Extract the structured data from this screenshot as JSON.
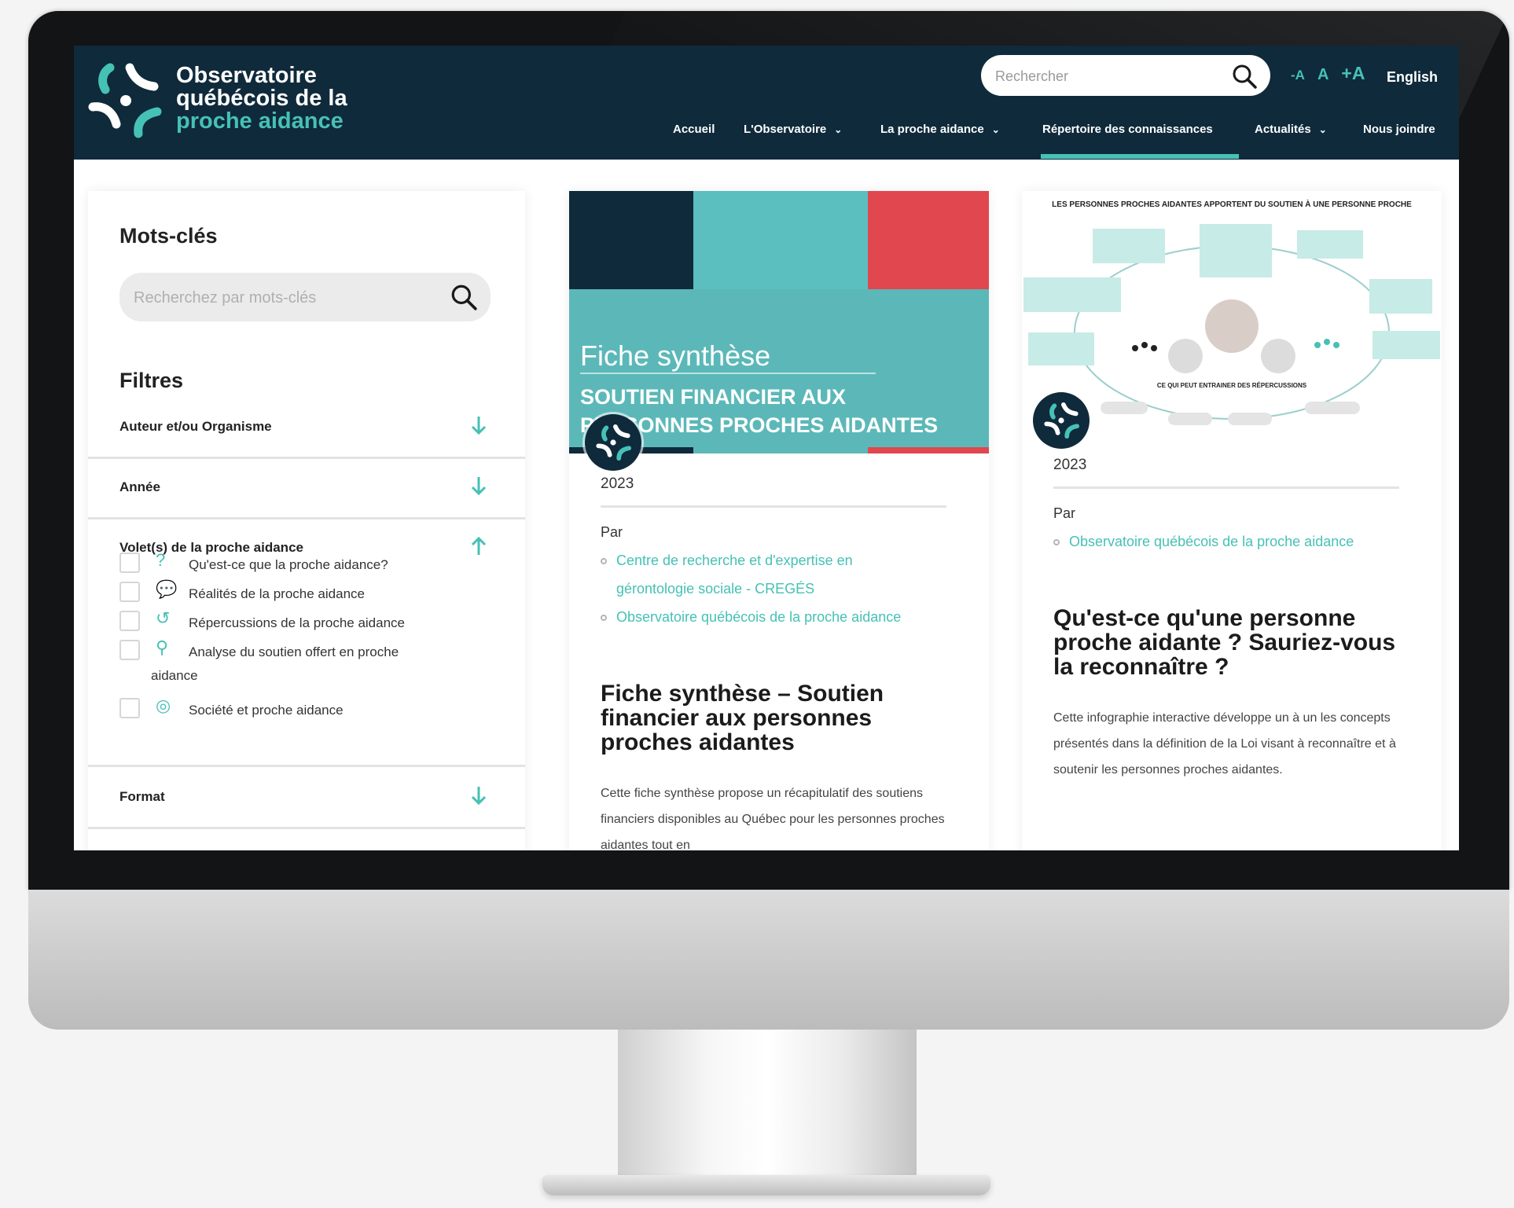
{
  "brand": {
    "line1": "Observatoire",
    "line2": "québécois de la",
    "line3": "proche aidance",
    "colors": {
      "navy": "#0f2a3b",
      "teal": "#46c1b5",
      "red": "#e0474f"
    }
  },
  "header": {
    "search_placeholder": "Rechercher",
    "font_controls": [
      "-A",
      "A",
      "+A"
    ],
    "language": "English"
  },
  "nav": {
    "items": [
      {
        "label": "Accueil",
        "has_dropdown": false
      },
      {
        "label": "L'Observatoire",
        "has_dropdown": true
      },
      {
        "label": "La proche aidance",
        "has_dropdown": true
      },
      {
        "label": "Répertoire des connaissances",
        "has_dropdown": false,
        "active": true
      },
      {
        "label": "Actualités",
        "has_dropdown": true
      },
      {
        "label": "Nous joindre",
        "has_dropdown": false
      }
    ]
  },
  "filters": {
    "keywords_heading": "Mots-clés",
    "keywords_placeholder": "Recherchez par mots-clés",
    "filters_heading": "Filtres",
    "groups": [
      {
        "label": "Auteur et/ou Organisme",
        "expanded": false
      },
      {
        "label": "Année",
        "expanded": false
      },
      {
        "label": "Volet(s) de la proche aidance",
        "expanded": true
      },
      {
        "label": "Format",
        "expanded": false
      }
    ],
    "volets": [
      {
        "label": "Qu'est-ce que la proche aidance?",
        "icon": "question-icon"
      },
      {
        "label": "Réalités de la proche aidance",
        "icon": "chat-icon"
      },
      {
        "label": "Répercussions de la proche aidance",
        "icon": "cycle-icon"
      },
      {
        "label": "Analyse du soutien offert en proche",
        "label_cont": "aidance",
        "icon": "magnifier-icon"
      },
      {
        "label": "Société et proche aidance",
        "icon": "globe-icon"
      }
    ]
  },
  "cards": [
    {
      "thumb_line1": "Fiche synthèse",
      "thumb_line2": "SOUTIEN FINANCIER AUX",
      "thumb_line3": "PERSONNES PROCHES AIDANTES",
      "year": "2023",
      "by_label": "Par",
      "authors": [
        "Centre de recherche et d'expertise en gérontologie sociale - CREGÉS",
        "Observatoire québécois de la proche aidance"
      ],
      "title": "Fiche synthèse – Soutien financier aux personnes proches aidantes",
      "description": "Cette fiche synthèse propose un récapitulatif des soutiens financiers disponibles au Québec pour les personnes proches aidantes tout en"
    },
    {
      "thumb_heading": "LES PERSONNES PROCHES AIDANTES APPORTENT DU SOUTIEN À UNE PERSONNE PROCHE",
      "thumb_center_label": "CE QUI PEUT ENTRAINER DES RÉPERCUSSIONS",
      "year": "2023",
      "by_label": "Par",
      "authors": [
        "Observatoire québécois de la proche aidance"
      ],
      "title": "Qu'est-ce qu'une personne proche aidante ? Sauriez-vous la reconnaître ?",
      "description": "Cette infographie interactive développe un à un les concepts présentés dans la définition de la Loi visant à reconnaître et à soutenir les personnes proches aidantes."
    }
  ]
}
